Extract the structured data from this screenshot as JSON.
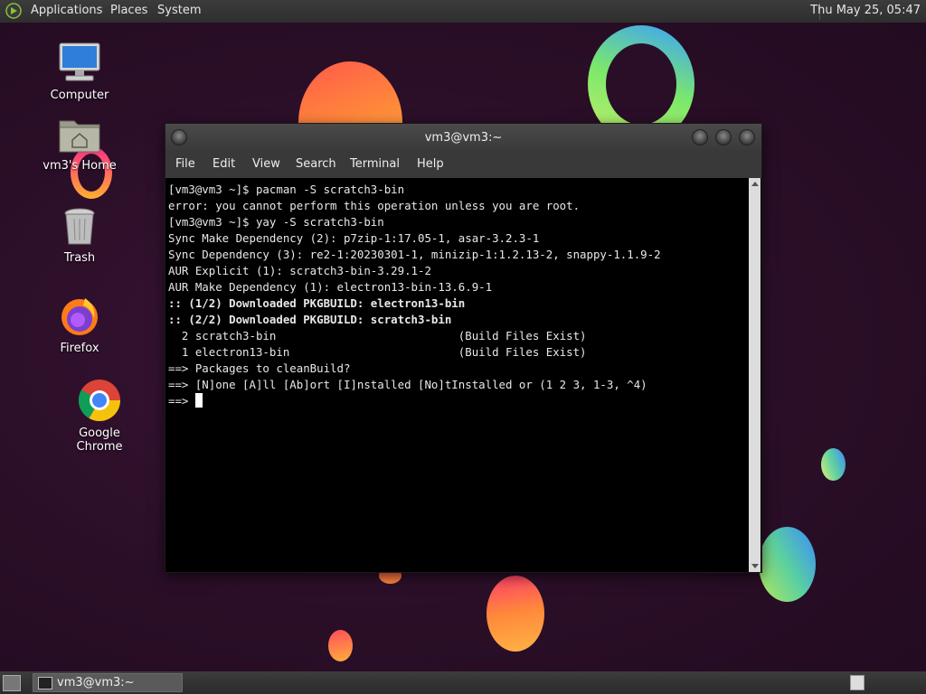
{
  "top_panel": {
    "menus": [
      "Applications",
      "Places",
      "System"
    ],
    "clock": "Thu May 25, 05:47"
  },
  "desktop_icons": [
    {
      "label": "Computer",
      "icon": "computer-icon"
    },
    {
      "label": "vm3's Home",
      "icon": "home-folder-icon"
    },
    {
      "label": "Trash",
      "icon": "trash-icon"
    },
    {
      "label": "Firefox",
      "icon": "firefox-icon"
    },
    {
      "label": "Google Chrome",
      "icon": "chrome-icon"
    }
  ],
  "window": {
    "title": "vm3@vm3:~",
    "menus": [
      "File",
      "Edit",
      "View",
      "Search",
      "Terminal",
      "Help"
    ]
  },
  "terminal": {
    "lines": [
      {
        "text": "[vm3@vm3 ~]$ pacman -S scratch3-bin",
        "bold": false
      },
      {
        "text": "error: you cannot perform this operation unless you are root.",
        "bold": false
      },
      {
        "text": "[vm3@vm3 ~]$ yay -S scratch3-bin",
        "bold": false
      },
      {
        "text": "Sync Make Dependency (2): p7zip-1:17.05-1, asar-3.2.3-1",
        "bold": false
      },
      {
        "text": "Sync Dependency (3): re2-1:20230301-1, minizip-1:1.2.13-2, snappy-1.1.9-2",
        "bold": false
      },
      {
        "text": "AUR Explicit (1): scratch3-bin-3.29.1-2",
        "bold": false
      },
      {
        "text": "AUR Make Dependency (1): electron13-bin-13.6.9-1",
        "bold": false
      },
      {
        "text": ":: (1/2) Downloaded PKGBUILD: electron13-bin",
        "bold": true
      },
      {
        "text": ":: (2/2) Downloaded PKGBUILD: scratch3-bin",
        "bold": true
      },
      {
        "text": "  2 scratch3-bin                           (Build Files Exist)",
        "bold": false
      },
      {
        "text": "  1 electron13-bin                         (Build Files Exist)",
        "bold": false
      },
      {
        "text": "==> Packages to cleanBuild?",
        "bold": false
      },
      {
        "text": "==> [N]one [A]ll [Ab]ort [I]nstalled [No]tInstalled or (1 2 3, 1-3, ^4)",
        "bold": false
      },
      {
        "text": "==> ",
        "bold": false
      }
    ]
  },
  "taskbar": {
    "task_label": "vm3@vm3:~"
  }
}
